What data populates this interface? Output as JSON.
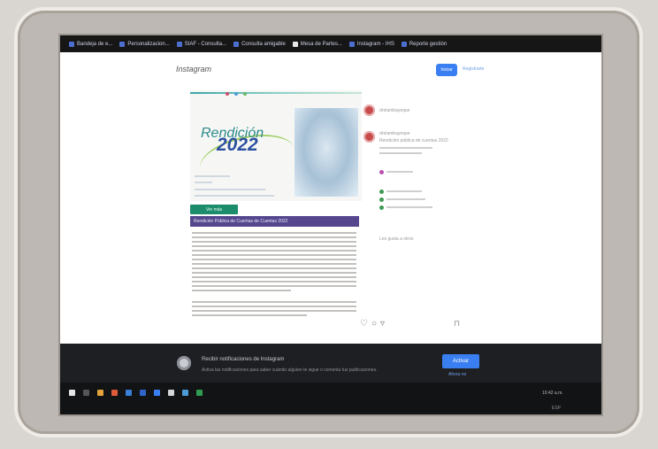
{
  "bookmarks": [
    {
      "label": "Bandeja de e..."
    },
    {
      "label": "Personalizacion..."
    },
    {
      "label": "SIAF - Consulta..."
    },
    {
      "label": "Consulta amigable"
    },
    {
      "label": "Mesa de Partes..."
    },
    {
      "label": "Instagram - IHS"
    },
    {
      "label": "Reporte gestión"
    }
  ],
  "header": {
    "logo": "Instagram",
    "login_label": "Iniciar",
    "signup_label": "Registrarte"
  },
  "post": {
    "banner_title": "Rendición",
    "banner_year": "2022",
    "button_label": "Ver más",
    "purple_bar_text": "Rendición Pública de Cuentas de Cuentas 2022"
  },
  "sidebar": {
    "account": "drelambayeque",
    "comment_user": "drelambayeque",
    "comment_text": "Rendición pública de cuentas 2022",
    "likes": "Les gusta a otros"
  },
  "notification": {
    "title": "Recibir notificaciones de Instagram",
    "body": "Activa las notificaciones para saber cuándo alguien te sigue o comenta tus publicaciones.",
    "button_label": "Activar",
    "link_label": "Ahora no"
  },
  "taskbar": {
    "time": "10:42 a.m.",
    "date": "ESP"
  },
  "colors": {
    "bookmarks_bg": "#161616",
    "accent_blue": "#3a7ff2",
    "post_purple": "#55468e",
    "post_green": "#1c8c6c",
    "taskbar_bg": "#121315"
  }
}
